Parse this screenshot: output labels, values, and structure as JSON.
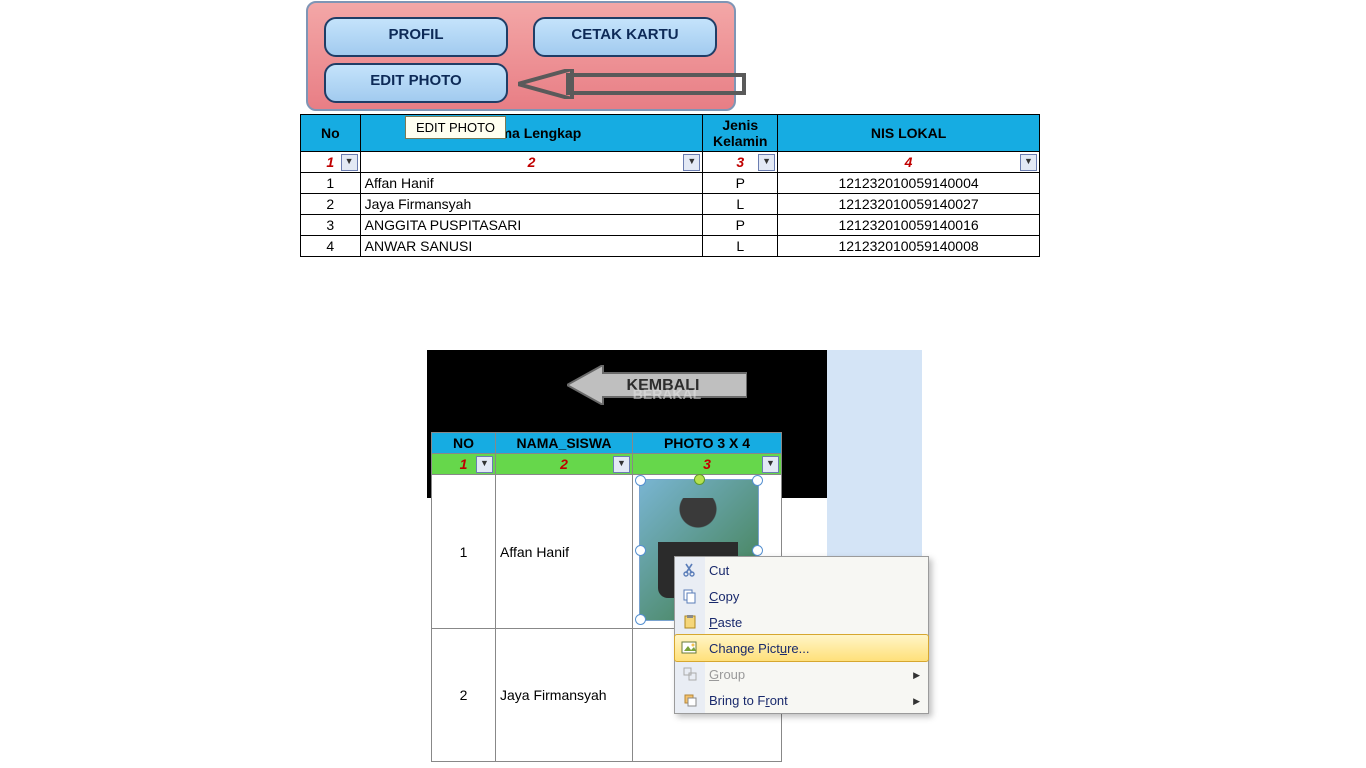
{
  "panel": {
    "profil": "PROFIL",
    "cetak": "CETAK KARTU",
    "editphoto": "EDIT PHOTO",
    "tooltip": "EDIT PHOTO"
  },
  "table1": {
    "headers": {
      "no": "No",
      "nama": "Nama Lengkap",
      "jk": "Jenis Kelamin",
      "nis": "NIS LOKAL"
    },
    "filters": {
      "c1": "1",
      "c2": "2",
      "c3": "3",
      "c4": "4"
    },
    "rows": [
      {
        "no": "1",
        "nama": "Affan Hanif",
        "jk": "P",
        "nis": "121232010059140004"
      },
      {
        "no": "2",
        "nama": "Jaya Firmansyah",
        "jk": "L",
        "nis": "121232010059140027"
      },
      {
        "no": "3",
        "nama": "ANGGITA PUSPITASARI",
        "jk": "P",
        "nis": "121232010059140016"
      },
      {
        "no": "4",
        "nama": "ANWAR SANUSI",
        "jk": "L",
        "nis": "121232010059140008"
      }
    ]
  },
  "kembali": "KEMBALI",
  "watermark": "BERAKAL",
  "table2": {
    "headers": {
      "no": "NO",
      "nama": "NAMA_SISWA",
      "photo": "PHOTO 3 X 4"
    },
    "filters": {
      "c1": "1",
      "c2": "2",
      "c3": "3"
    },
    "rows": [
      {
        "no": "1",
        "nama": "Affan Hanif"
      },
      {
        "no": "2",
        "nama": "Jaya Firmansyah"
      }
    ]
  },
  "ctx": {
    "cut": "Cut",
    "copy": "Copy",
    "paste": "Paste",
    "change": "Change Picture...",
    "group": "Group",
    "bring": "Bring to Front"
  }
}
